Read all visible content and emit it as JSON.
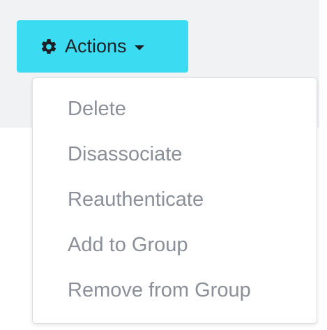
{
  "colors": {
    "button_background": "#3bdcf2",
    "button_text": "#1d1f24",
    "menu_text": "#8a8f98",
    "menu_border": "#dcdde0",
    "page_background": "#f1f2f4"
  },
  "actions_button": {
    "icon": "gear-icon",
    "label": "Actions",
    "caret_icon": "caret-down-icon"
  },
  "dropdown": {
    "items": [
      {
        "label": "Delete"
      },
      {
        "label": "Disassociate"
      },
      {
        "label": "Reauthenticate"
      },
      {
        "label": "Add to Group"
      },
      {
        "label": "Remove from Group"
      }
    ]
  }
}
